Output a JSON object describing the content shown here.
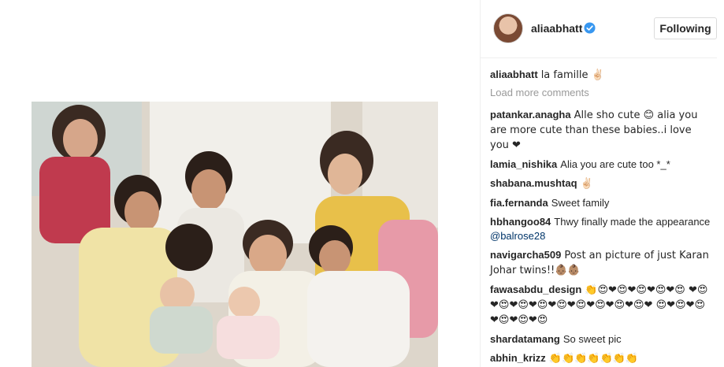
{
  "post": {
    "username": "aliaabhatt",
    "follow_label": "Following",
    "caption_user": "aliaabhatt",
    "caption_text": "la famille ✌🏻",
    "load_more": "Load more comments"
  },
  "comments": [
    {
      "user": "patankar.anagha",
      "text": "Alle sho cute 😊 alia you are more cute than these babies..i love you ❤"
    },
    {
      "user": "lamia_nishika",
      "text": "Alia you are cute too *_*"
    },
    {
      "user": "shabana.mushtaq",
      "text": "✌🏻"
    },
    {
      "user": "fia.fernanda",
      "text": "Sweet family"
    },
    {
      "user": "hbhangoo84",
      "text": "Thwy finally made the appearance",
      "mention": "@balrose28"
    },
    {
      "user": "navigarcha509",
      "text": "Post an picture of just Karan Johar twins!!👶🏽👶🏽"
    },
    {
      "user": "fawasabdu_design",
      "text": "👏😍❤😍❤😍❤😍❤😍 ❤😍❤😍❤😍❤😍❤😍❤😍❤😍❤😍❤😍❤ 😍❤😍❤😍❤😍❤😍❤😍"
    },
    {
      "user": "shardatamang",
      "text": "So sweet pic"
    },
    {
      "user": "abhin_krizz",
      "text": "👏👏👏👏👏👏👏"
    }
  ],
  "colors": {
    "verified": "#3897f0",
    "border": "#dbdbdb",
    "muted": "#999999",
    "mention": "#003569"
  },
  "icons": {
    "verified": "verified-badge-icon"
  }
}
